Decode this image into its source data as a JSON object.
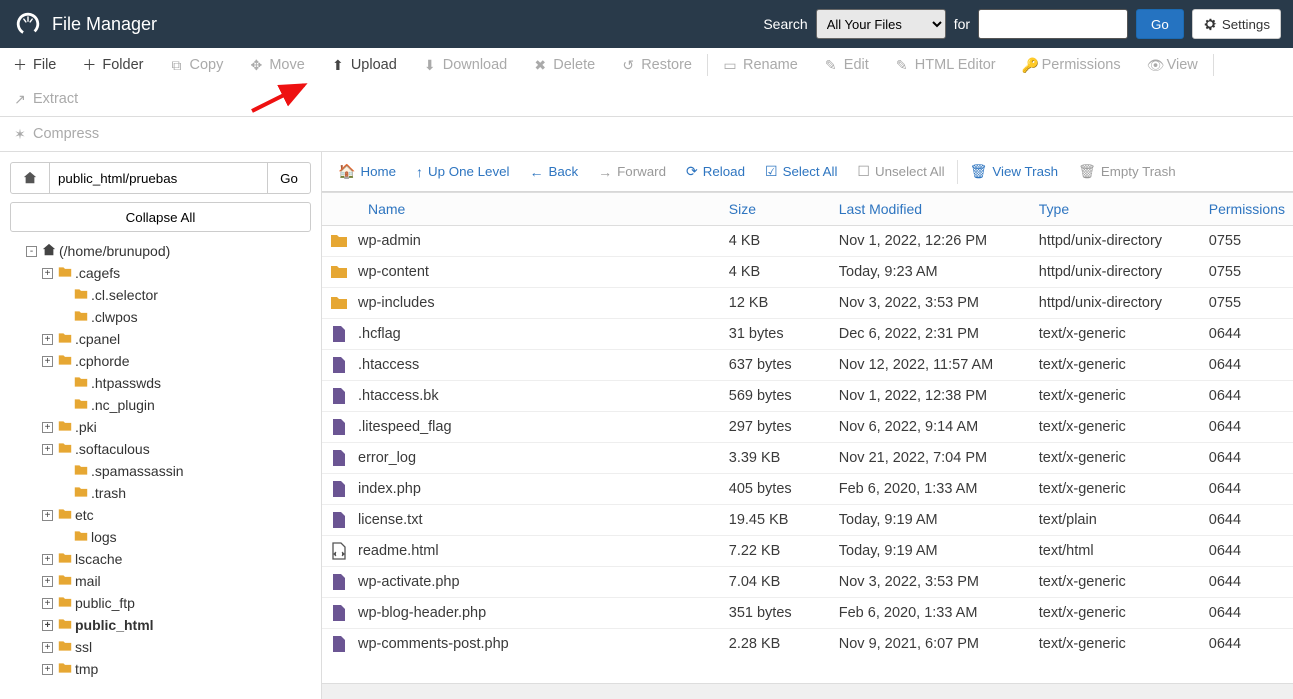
{
  "header": {
    "title": "File Manager",
    "search_label": "Search",
    "search_scope_options": [
      "All Your Files"
    ],
    "search_scope_selected": "All Your Files",
    "for_label": "for",
    "search_value": "",
    "go_label": "Go",
    "settings_label": "Settings"
  },
  "toolbar": {
    "file": "File",
    "folder": "Folder",
    "copy": "Copy",
    "move": "Move",
    "upload": "Upload",
    "download": "Download",
    "delete": "Delete",
    "restore": "Restore",
    "rename": "Rename",
    "edit": "Edit",
    "html_editor": "HTML Editor",
    "permissions": "Permissions",
    "view": "View",
    "extract": "Extract",
    "compress": "Compress"
  },
  "left": {
    "path_value": "public_html/pruebas",
    "go_label": "Go",
    "collapse_label": "Collapse All",
    "root_label": "(/home/brunupod)",
    "tree": [
      {
        "indent": 0,
        "exp": "-",
        "icon": "home",
        "label": "(/home/brunupod)",
        "bold": false
      },
      {
        "indent": 1,
        "exp": "+",
        "icon": "folder",
        "label": ".cagefs"
      },
      {
        "indent": 2,
        "exp": "",
        "icon": "folder",
        "label": ".cl.selector"
      },
      {
        "indent": 2,
        "exp": "",
        "icon": "folder",
        "label": ".clwpos"
      },
      {
        "indent": 1,
        "exp": "+",
        "icon": "folder",
        "label": ".cpanel"
      },
      {
        "indent": 1,
        "exp": "+",
        "icon": "folder",
        "label": ".cphorde"
      },
      {
        "indent": 2,
        "exp": "",
        "icon": "folder",
        "label": ".htpasswds"
      },
      {
        "indent": 2,
        "exp": "",
        "icon": "folder",
        "label": ".nc_plugin"
      },
      {
        "indent": 1,
        "exp": "+",
        "icon": "folder",
        "label": ".pki"
      },
      {
        "indent": 1,
        "exp": "+",
        "icon": "folder",
        "label": ".softaculous"
      },
      {
        "indent": 2,
        "exp": "",
        "icon": "folder",
        "label": ".spamassassin"
      },
      {
        "indent": 2,
        "exp": "",
        "icon": "folder",
        "label": ".trash"
      },
      {
        "indent": 1,
        "exp": "+",
        "icon": "folder",
        "label": "etc"
      },
      {
        "indent": 2,
        "exp": "",
        "icon": "folder",
        "label": "logs"
      },
      {
        "indent": 1,
        "exp": "+",
        "icon": "folder",
        "label": "lscache"
      },
      {
        "indent": 1,
        "exp": "+",
        "icon": "folder",
        "label": "mail"
      },
      {
        "indent": 1,
        "exp": "+",
        "icon": "folder",
        "label": "public_ftp"
      },
      {
        "indent": 1,
        "exp": "+",
        "icon": "folder",
        "label": "public_html",
        "bold": true
      },
      {
        "indent": 1,
        "exp": "+",
        "icon": "folder",
        "label": "ssl"
      },
      {
        "indent": 1,
        "exp": "+",
        "icon": "folder",
        "label": "tmp"
      }
    ]
  },
  "actionbar": {
    "home": "Home",
    "up": "Up One Level",
    "back": "Back",
    "forward": "Forward",
    "reload": "Reload",
    "select_all": "Select All",
    "unselect_all": "Unselect All",
    "view_trash": "View Trash",
    "empty_trash": "Empty Trash"
  },
  "table": {
    "headers": {
      "name": "Name",
      "size": "Size",
      "modified": "Last Modified",
      "type": "Type",
      "permissions": "Permissions"
    },
    "rows": [
      {
        "icon": "folder",
        "name": "wp-admin",
        "size": "4 KB",
        "modified": "Nov 1, 2022, 12:26 PM",
        "type": "httpd/unix-directory",
        "perm": "0755"
      },
      {
        "icon": "folder",
        "name": "wp-content",
        "size": "4 KB",
        "modified": "Today, 9:23 AM",
        "type": "httpd/unix-directory",
        "perm": "0755"
      },
      {
        "icon": "folder",
        "name": "wp-includes",
        "size": "12 KB",
        "modified": "Nov 3, 2022, 3:53 PM",
        "type": "httpd/unix-directory",
        "perm": "0755"
      },
      {
        "icon": "file",
        "name": ".hcflag",
        "size": "31 bytes",
        "modified": "Dec 6, 2022, 2:31 PM",
        "type": "text/x-generic",
        "perm": "0644"
      },
      {
        "icon": "file",
        "name": ".htaccess",
        "size": "637 bytes",
        "modified": "Nov 12, 2022, 11:57 AM",
        "type": "text/x-generic",
        "perm": "0644"
      },
      {
        "icon": "file",
        "name": ".htaccess.bk",
        "size": "569 bytes",
        "modified": "Nov 1, 2022, 12:38 PM",
        "type": "text/x-generic",
        "perm": "0644"
      },
      {
        "icon": "file",
        "name": ".litespeed_flag",
        "size": "297 bytes",
        "modified": "Nov 6, 2022, 9:14 AM",
        "type": "text/x-generic",
        "perm": "0644"
      },
      {
        "icon": "file",
        "name": "error_log",
        "size": "3.39 KB",
        "modified": "Nov 21, 2022, 7:04 PM",
        "type": "text/x-generic",
        "perm": "0644"
      },
      {
        "icon": "file",
        "name": "index.php",
        "size": "405 bytes",
        "modified": "Feb 6, 2020, 1:33 AM",
        "type": "text/x-generic",
        "perm": "0644"
      },
      {
        "icon": "file",
        "name": "license.txt",
        "size": "19.45 KB",
        "modified": "Today, 9:19 AM",
        "type": "text/plain",
        "perm": "0644"
      },
      {
        "icon": "html",
        "name": "readme.html",
        "size": "7.22 KB",
        "modified": "Today, 9:19 AM",
        "type": "text/html",
        "perm": "0644"
      },
      {
        "icon": "file",
        "name": "wp-activate.php",
        "size": "7.04 KB",
        "modified": "Nov 3, 2022, 3:53 PM",
        "type": "text/x-generic",
        "perm": "0644"
      },
      {
        "icon": "file",
        "name": "wp-blog-header.php",
        "size": "351 bytes",
        "modified": "Feb 6, 2020, 1:33 AM",
        "type": "text/x-generic",
        "perm": "0644"
      },
      {
        "icon": "file",
        "name": "wp-comments-post.php",
        "size": "2.28 KB",
        "modified": "Nov 9, 2021, 6:07 PM",
        "type": "text/x-generic",
        "perm": "0644"
      }
    ]
  }
}
